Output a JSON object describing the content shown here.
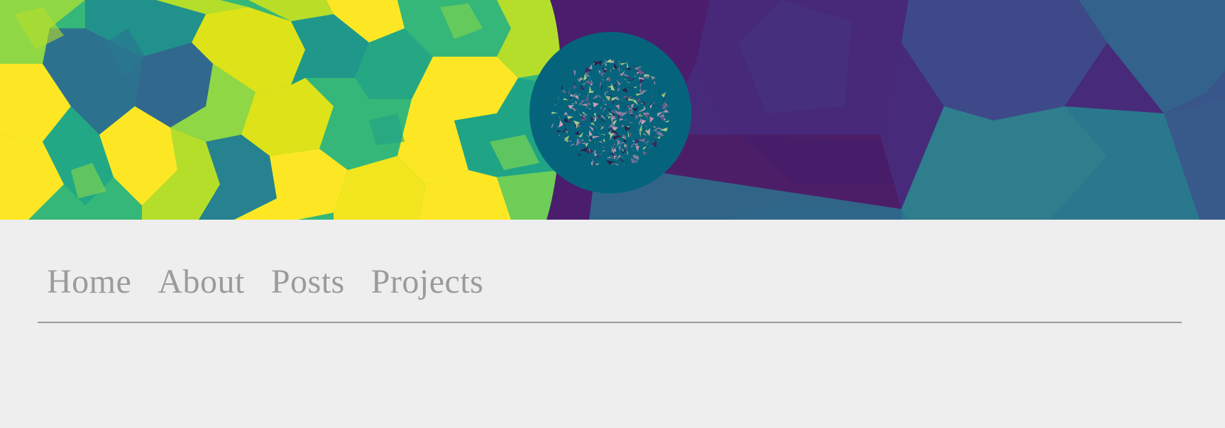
{
  "header": {
    "image_name": "generative-voronoi-banner",
    "palette": [
      "#fde725",
      "#b5de2b",
      "#6ece58",
      "#35b779",
      "#1f9e89",
      "#26828e",
      "#31688e",
      "#3e4989",
      "#482878",
      "#440154"
    ],
    "logo_color": "#05647c"
  },
  "nav": {
    "items": [
      {
        "label": "Home"
      },
      {
        "label": "About"
      },
      {
        "label": "Posts"
      },
      {
        "label": "Projects"
      }
    ],
    "text_color": "#9b9b9b",
    "rule_color": "#9a9a9a"
  },
  "page": {
    "background": "#eeeeee"
  }
}
